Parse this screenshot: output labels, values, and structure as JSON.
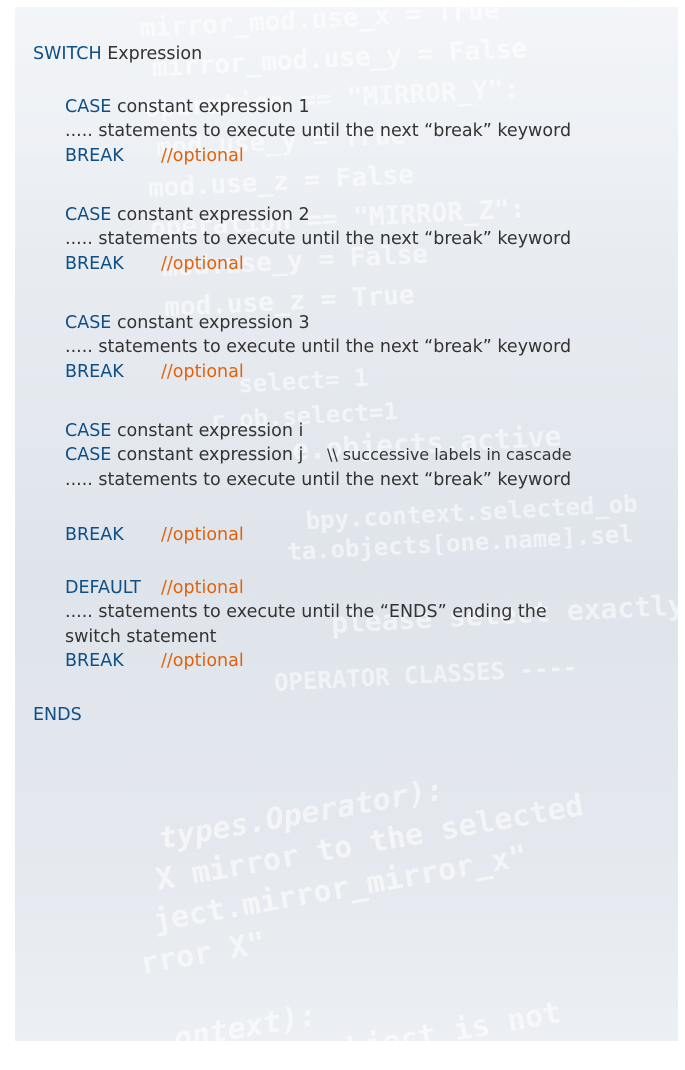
{
  "keywords": {
    "switch": "SWITCH",
    "case": "CASE",
    "break": "BREAK",
    "default": "DEFAULT",
    "ends": "ENDS"
  },
  "optional_comment": "//optional",
  "switch_expression": "Expression",
  "case_expressions": [
    "constant expression 1",
    "constant expression 2",
    "constant expression 3",
    "constant expression i",
    "constant expression j"
  ],
  "statements_until_break": "..... statements to execute until the next “break” keyword",
  "cascade_comment": "\\\\ successive labels in cascade",
  "default_statements_line1": "..... statements to execute until the “ENDS” ending the",
  "default_statements_line2": "switch statement",
  "colors": {
    "keyword": "#0e4f86",
    "comment": "#e0620c",
    "text": "#333333",
    "background": "#e4e8ee"
  }
}
